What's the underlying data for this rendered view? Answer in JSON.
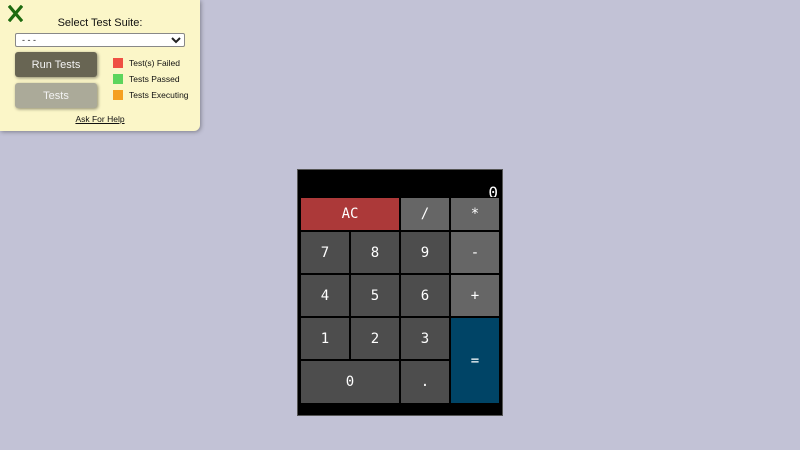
{
  "test_panel": {
    "close_icon": "close-x-icon",
    "close_color": "#1e6b10",
    "title": "Select Test Suite:",
    "select_value": "- - -",
    "run_tests_label": "Run Tests",
    "tests_label": "Tests",
    "legend": [
      {
        "label": "Test(s) Failed",
        "color": "#ef5044"
      },
      {
        "label": "Tests Passed",
        "color": "#5dd55d"
      },
      {
        "label": "Tests Executing",
        "color": "#f5a020"
      }
    ],
    "help_link": "Ask For Help"
  },
  "calculator": {
    "display": "0",
    "keys": {
      "clear": "AC",
      "divide": "/",
      "multiply": "*",
      "seven": "7",
      "eight": "8",
      "nine": "9",
      "subtract": "-",
      "four": "4",
      "five": "5",
      "six": "6",
      "add": "+",
      "one": "1",
      "two": "2",
      "three": "3",
      "equals": "=",
      "zero": "0",
      "decimal": "."
    },
    "colors": {
      "background": "#000000",
      "clear": "#ac3939",
      "operator": "#666666",
      "digit": "#4d4d4d",
      "equals": "#004466"
    }
  }
}
